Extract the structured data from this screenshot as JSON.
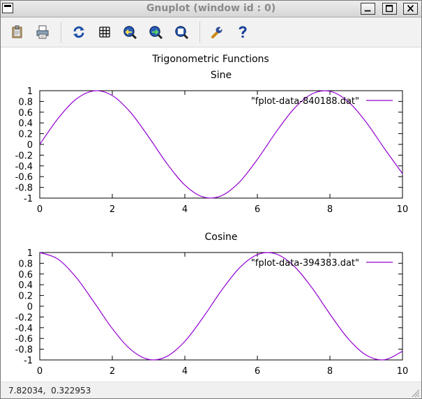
{
  "window": {
    "title": "Gnuplot (window id : 0)"
  },
  "toolbar": {
    "buttons": [
      {
        "name": "copy-to-clipboard",
        "icon": "clipboard-icon"
      },
      {
        "name": "print",
        "icon": "printer-icon"
      },
      {
        "name": "replot",
        "icon": "refresh-icon"
      },
      {
        "name": "toggle-grid",
        "icon": "grid-icon"
      },
      {
        "name": "previous-zoom",
        "icon": "zoom-previous-icon"
      },
      {
        "name": "next-zoom",
        "icon": "zoom-next-icon"
      },
      {
        "name": "autoscale",
        "icon": "zoom-autoscale-icon"
      },
      {
        "name": "settings",
        "icon": "wrench-icon"
      },
      {
        "name": "help",
        "icon": "question-icon"
      }
    ]
  },
  "figure": {
    "title": "Trigonometric Functions"
  },
  "chart_data": [
    {
      "type": "line",
      "title": "Sine",
      "xlabel": "",
      "ylabel": "",
      "xlim": [
        0,
        10
      ],
      "ylim": [
        -1,
        1
      ],
      "xticks": [
        "0",
        "2",
        "4",
        "6",
        "8",
        "10"
      ],
      "yticks": [
        "1",
        "0.8",
        "0.6",
        "0.4",
        "0.2",
        "0",
        "-0.2",
        "-0.4",
        "-0.6",
        "-0.8",
        "-1"
      ],
      "grid": false,
      "legend_position": "top-right",
      "series": [
        {
          "name": "\"fplot-data-840188.dat\"",
          "color": "#9400d3",
          "x": [
            0,
            0.5,
            1,
            1.5,
            2,
            2.5,
            3,
            3.5,
            4,
            4.5,
            5,
            5.5,
            6,
            6.5,
            7,
            7.5,
            8,
            8.5,
            9,
            9.5,
            10
          ],
          "y": [
            0,
            0.479,
            0.841,
            0.997,
            0.909,
            0.598,
            0.141,
            -0.351,
            -0.757,
            -0.978,
            -0.959,
            -0.706,
            -0.279,
            0.215,
            0.657,
            0.938,
            0.989,
            0.798,
            0.412,
            -0.075,
            -0.544
          ]
        }
      ]
    },
    {
      "type": "line",
      "title": "Cosine",
      "xlabel": "",
      "ylabel": "",
      "xlim": [
        0,
        10
      ],
      "ylim": [
        -1,
        1
      ],
      "xticks": [
        "0",
        "2",
        "4",
        "6",
        "8",
        "10"
      ],
      "yticks": [
        "1",
        "0.8",
        "0.6",
        "0.4",
        "0.2",
        "0",
        "-0.2",
        "-0.4",
        "-0.6",
        "-0.8",
        "-1"
      ],
      "grid": false,
      "legend_position": "top-right",
      "series": [
        {
          "name": "\"fplot-data-394383.dat\"",
          "color": "#9400d3",
          "x": [
            0,
            0.5,
            1,
            1.5,
            2,
            2.5,
            3,
            3.5,
            4,
            4.5,
            5,
            5.5,
            6,
            6.5,
            7,
            7.5,
            8,
            8.5,
            9,
            9.5,
            10
          ],
          "y": [
            1,
            0.878,
            0.54,
            0.071,
            -0.416,
            -0.801,
            -0.99,
            -0.936,
            -0.654,
            -0.211,
            0.284,
            0.709,
            0.96,
            0.977,
            0.754,
            0.347,
            -0.146,
            -0.602,
            -0.911,
            -0.997,
            -0.839
          ]
        }
      ]
    }
  ],
  "status": {
    "coordinates": "7.82034,  0.322953"
  }
}
